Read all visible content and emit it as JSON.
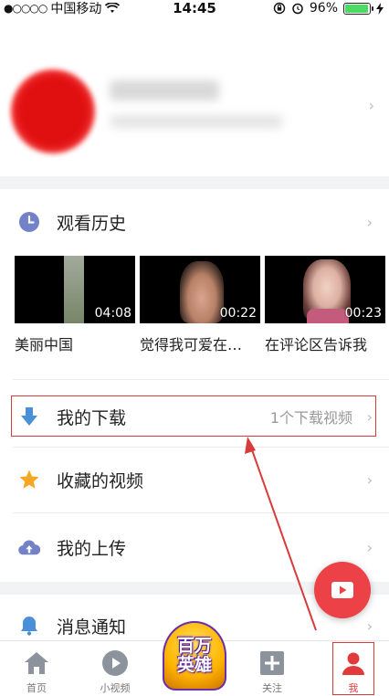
{
  "status_bar": {
    "signal": "●○○○○",
    "carrier": "中国移动",
    "time": "14:45",
    "battery": "96%",
    "battery_level": 0.96
  },
  "history": {
    "title": "观看历史",
    "videos": [
      {
        "title": "美丽中国",
        "duration": "04:08"
      },
      {
        "title": "觉得我可爱在…",
        "duration": "00:22"
      },
      {
        "title": "在评论区告诉我",
        "duration": "00:23"
      }
    ]
  },
  "menu": {
    "downloads": {
      "label": "我的下载",
      "info": "1个下载视频"
    },
    "favorites": {
      "label": "收藏的视频"
    },
    "uploads": {
      "label": "我的上传"
    },
    "notifications": {
      "label": "消息通知"
    }
  },
  "tabbar": {
    "home": "首页",
    "short_video": "小视频",
    "promo_line1": "百万",
    "promo_line2": "英雄",
    "follow": "关注",
    "me": "我"
  },
  "colors": {
    "accent": "#e23a3a",
    "annotation": "#d93a3a"
  }
}
